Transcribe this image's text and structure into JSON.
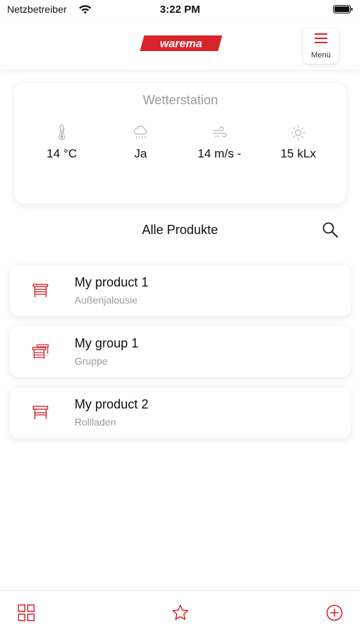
{
  "status_bar": {
    "carrier": "Netzbetreiber",
    "time": "3:22 PM"
  },
  "header": {
    "logo_text": "warema",
    "menu_label": "Menü"
  },
  "weather": {
    "title": "Wetterstation",
    "items": [
      {
        "icon": "thermometer-icon",
        "value": "14 °C"
      },
      {
        "icon": "rain-cloud-icon",
        "value": "Ja"
      },
      {
        "icon": "wind-icon",
        "value": "14 m/s -"
      },
      {
        "icon": "sun-icon",
        "value": "15 kLx"
      }
    ]
  },
  "products_section": {
    "title": "Alle Produkte"
  },
  "products": [
    {
      "name": "My product 1",
      "type": "Außenjalousie",
      "icon": "venetian-blind-icon"
    },
    {
      "name": "My group 1",
      "type": "Gruppe",
      "icon": "group-blinds-icon"
    },
    {
      "name": "My product 2",
      "type": "Rollladen",
      "icon": "roller-shutter-icon"
    }
  ],
  "tab_bar": {
    "items": [
      {
        "icon": "grid-icon"
      },
      {
        "icon": "star-icon"
      },
      {
        "icon": "add-circle-icon"
      }
    ]
  },
  "colors": {
    "accent": "#d8232a",
    "muted_text": "#9a9a9a",
    "weather_icon": "#b5b5b5"
  }
}
